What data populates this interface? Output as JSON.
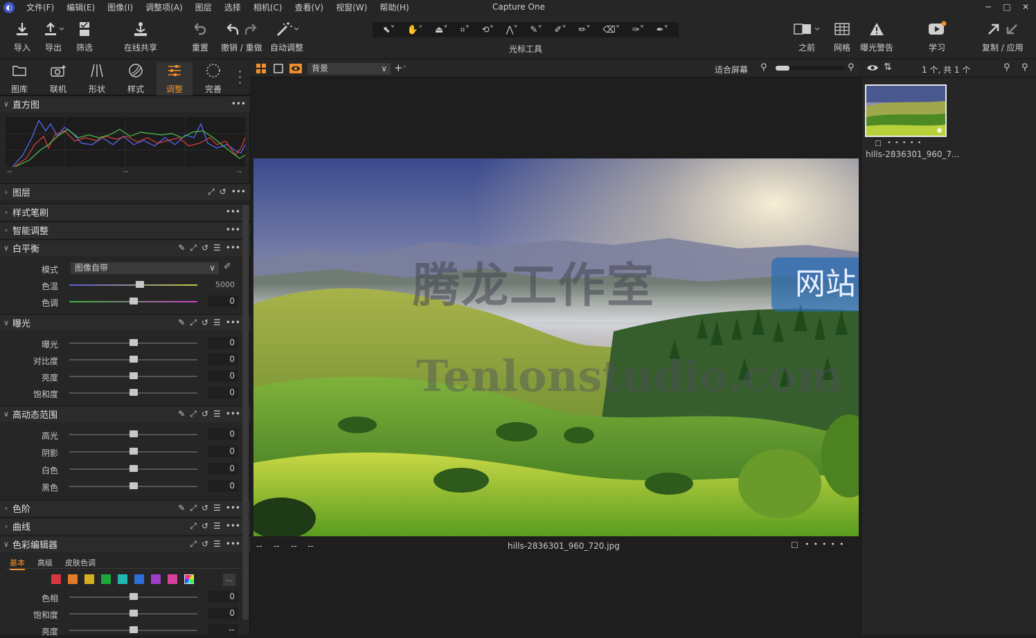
{
  "menubar": {
    "items": [
      "文件(F)",
      "编辑(E)",
      "图像(I)",
      "调整项(A)",
      "图层",
      "选择",
      "相机(C)",
      "查看(V)",
      "视窗(W)",
      "帮助(H)"
    ],
    "app_title": "Capture One",
    "minimize": "─",
    "maximize": "□",
    "close": "✕"
  },
  "toolbar": {
    "import": "导入",
    "export": "导出",
    "filter": "筛选",
    "share": "在线共享",
    "reset": "重置",
    "undo_redo": "撤销 / 重做",
    "auto_adjust": "自动调整",
    "cursor_tools": "光标工具",
    "before": "之前",
    "grid": "网格",
    "exposure_warning": "曝光警告",
    "learn": "学习",
    "copy_apply": "复制 / 应用"
  },
  "tool_tabs": [
    {
      "label": "图库",
      "icon": "folder-icon"
    },
    {
      "label": "联机",
      "icon": "camera-icon"
    },
    {
      "label": "形状",
      "icon": "lens-icon"
    },
    {
      "label": "样式",
      "icon": "style-icon"
    },
    {
      "label": "调整",
      "icon": "sliders-icon",
      "active": true
    },
    {
      "label": "完善",
      "icon": "refine-icon"
    }
  ],
  "sections": {
    "histogram": "直方图",
    "histogram_footer": [
      "--",
      "--",
      "--"
    ],
    "layers": "图层",
    "style_brush": "样式笔刷",
    "smart_adjust": "智能调整",
    "white_balance": "白平衡",
    "exposure": "曝光",
    "hdr": "高动态范围",
    "levels": "色阶",
    "curve": "曲线",
    "color_editor": "色彩编辑器"
  },
  "white_balance": {
    "mode_label": "模式",
    "mode_value": "图像自带",
    "rows": [
      {
        "label": "色温",
        "value": "5000",
        "level": 0.55
      },
      {
        "label": "色调",
        "value": "0",
        "level": 0.5
      }
    ]
  },
  "exposure": {
    "rows": [
      {
        "label": "曝光",
        "value": "0",
        "level": 0.5
      },
      {
        "label": "对比度",
        "value": "0",
        "level": 0.5
      },
      {
        "label": "亮度",
        "value": "0",
        "level": 0.5
      },
      {
        "label": "饱和度",
        "value": "0",
        "level": 0.5
      }
    ]
  },
  "hdr": {
    "rows": [
      {
        "label": "高光",
        "value": "0",
        "level": 0.5
      },
      {
        "label": "阴影",
        "value": "0",
        "level": 0.5
      },
      {
        "label": "白色",
        "value": "0",
        "level": 0.5
      },
      {
        "label": "黑色",
        "value": "0",
        "level": 0.5
      }
    ]
  },
  "color_editor": {
    "tabs": [
      "基本",
      "高级",
      "皮肤色调"
    ],
    "more": "...",
    "swatches": [
      "#d9363e",
      "#e07b2a",
      "#d4b01e",
      "#1ea83a",
      "#1fb8b0",
      "#2d6fd6",
      "#9b3fc9",
      "#d63f9c"
    ],
    "rows": [
      {
        "label": "色相",
        "value": "0",
        "level": 0.5
      },
      {
        "label": "饱和度",
        "value": "0",
        "level": 0.5
      },
      {
        "label": "亮度",
        "value": "--",
        "level": 0.5
      }
    ]
  },
  "viewer": {
    "layer_select": "背景",
    "fit_label": "适合屏幕",
    "filename": "hills-2836301_960_720.jpg",
    "footer_left": [
      "--",
      "--",
      "--",
      "--"
    ]
  },
  "browser": {
    "count": "1 个, 共 1 个",
    "thumb_name": "hills-2836301_960_7..."
  },
  "watermark": {
    "text_cn": "腾龙工作室",
    "badge": "网站",
    "text_en": "Tenlonstudio.com"
  },
  "colors": {
    "accent": "#f0902a",
    "panel": "#262626",
    "background": "#1e1e1e"
  }
}
